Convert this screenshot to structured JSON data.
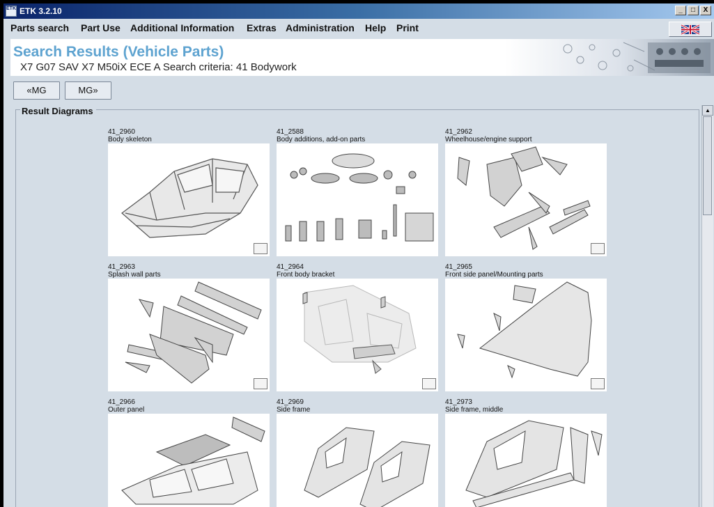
{
  "window": {
    "title": "ETK 3.2.10",
    "app_icon_text": "ETK",
    "controls": [
      "_",
      "□",
      "X"
    ]
  },
  "menu": {
    "items": [
      "Parts search",
      "Part Use",
      "Additional Information",
      "Extras",
      "Administration",
      "Help",
      "Print"
    ]
  },
  "header": {
    "title": "Search Results (Vehicle Parts)",
    "subtitle": "X7 G07 SAV X7 M50iX ECE  A   Search criteria: 41 Bodywork"
  },
  "nav": {
    "prev_label": "«MG",
    "next_label": "MG»"
  },
  "results": {
    "legend": "Result Diagrams",
    "diagrams": [
      {
        "number": "41_2960",
        "name": "Body skeleton",
        "icon": "body-skeleton-drawing"
      },
      {
        "number": "41_2588",
        "name": "Body additions, add-on parts",
        "icon": "fasteners-drawing"
      },
      {
        "number": "41_2962",
        "name": "Wheelhouse/engine support",
        "icon": "wheelhouse-drawing"
      },
      {
        "number": "41_2963",
        "name": "Splash wall parts",
        "icon": "splash-wall-drawing"
      },
      {
        "number": "41_2964",
        "name": "Front body bracket",
        "icon": "front-bracket-drawing"
      },
      {
        "number": "41_2965",
        "name": "Front side panel/Mounting parts",
        "icon": "side-panel-drawing"
      },
      {
        "number": "41_2966",
        "name": "Outer panel",
        "icon": "outer-panel-drawing"
      },
      {
        "number": "41_2969",
        "name": "Side frame",
        "icon": "side-frame-drawing"
      },
      {
        "number": "41_2973",
        "name": "Side frame, middle",
        "icon": "side-frame-middle-drawing"
      }
    ]
  }
}
